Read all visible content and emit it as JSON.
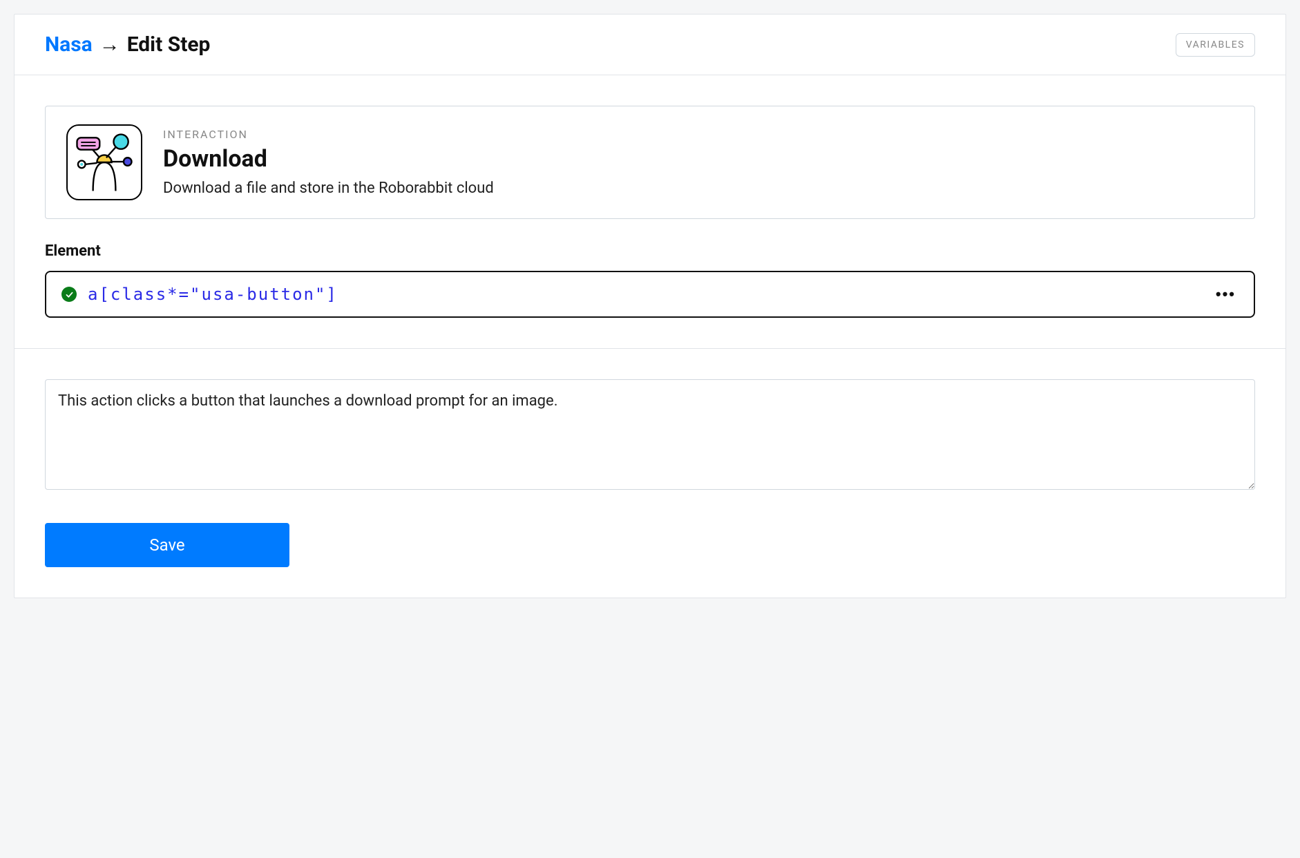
{
  "header": {
    "breadcrumb_link": "Nasa",
    "breadcrumb_arrow": "→",
    "breadcrumb_current": "Edit Step",
    "variables_button_label": "VARIABLES"
  },
  "interaction": {
    "label": "INTERACTION",
    "title": "Download",
    "description": "Download a file and store in the Roborabbit cloud"
  },
  "element": {
    "label": "Element",
    "selector": "a[class*=\"usa-button\"]"
  },
  "description": {
    "value": "This action clicks a button that launches a download prompt for an image."
  },
  "actions": {
    "save_label": "Save"
  }
}
